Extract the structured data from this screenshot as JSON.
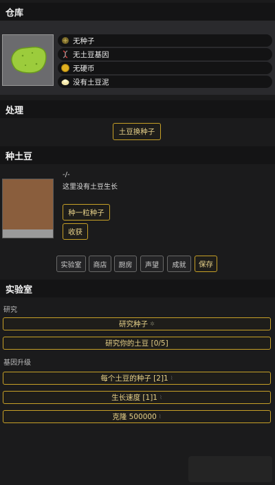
{
  "warehouse": {
    "title": "仓库",
    "items": [
      {
        "icon": "seed-icon",
        "label": "无种子"
      },
      {
        "icon": "dna-icon",
        "label": "无土豆基因"
      },
      {
        "icon": "coin-icon",
        "label": "无硬币"
      },
      {
        "icon": "mash-icon",
        "label": "没有土豆泥"
      }
    ]
  },
  "process": {
    "title": "处理",
    "exchange_button": "土豆换种子"
  },
  "plant": {
    "title": "种土豆",
    "status": "-/-",
    "message": "这里没有土豆生长",
    "plant_button": "种一粒种子",
    "harvest_button": "收获"
  },
  "tabs": [
    "实验室",
    "商店",
    "厨房",
    "声望",
    "成就",
    "保存"
  ],
  "lab": {
    "title": "实验室",
    "research_label": "研究",
    "research_seeds": "研究种子",
    "research_potato": "研究你的土豆 [0/5]",
    "gene_label": "基因升级",
    "seeds_per_potato": "每个土豆的种子 [2]1",
    "growth_speed": "生长速度 [1]1",
    "clone": "克隆 500000"
  },
  "colors": {
    "background": "#1b1b1c",
    "header": "#141415",
    "gold": "#c9a227",
    "potato_green": "#9ccc3c",
    "soil": "#8a5e3d"
  }
}
